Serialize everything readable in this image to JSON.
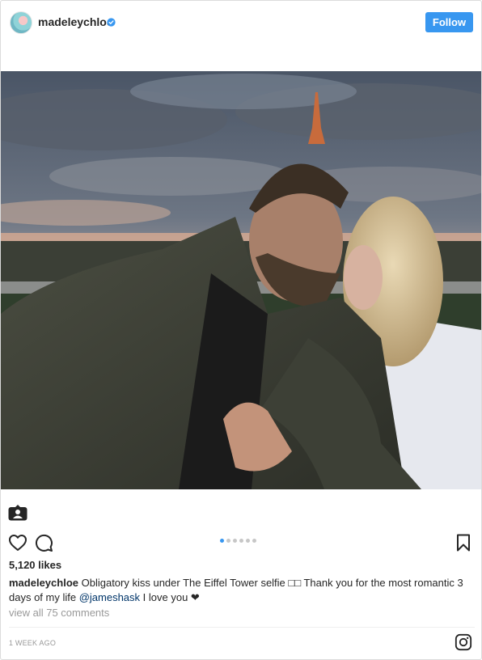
{
  "header": {
    "username": "madeleychloe",
    "verified_icon": "verified-badge-icon",
    "follow_label": "Follow",
    "accent_color": "#3897f0"
  },
  "photo": {
    "alt_description_icon": "user-tag-icon"
  },
  "carousel": {
    "dot_count": 6,
    "active_index": 0
  },
  "actions": {
    "like_icon": "heart-icon",
    "comment_icon": "comment-bubble-icon",
    "save_icon": "bookmark-icon"
  },
  "stats": {
    "likes": "5,120 likes"
  },
  "caption": {
    "user": "madeleychloe",
    "text_before_mention": " Obligatory kiss under The Eiffel Tower selfie □□ Thank you for the most romantic 3 days of my life ",
    "mention": "@jameshask",
    "text_after_mention": " I love you ❤"
  },
  "comments": {
    "view_all": "view all 75 comments"
  },
  "footer": {
    "timestamp": "1 WEEK AGO",
    "logo_icon": "instagram-icon"
  }
}
